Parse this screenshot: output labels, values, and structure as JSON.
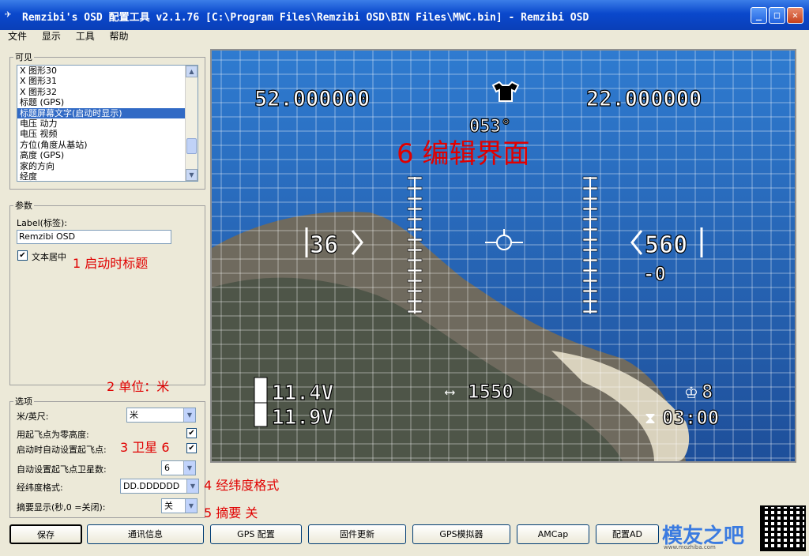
{
  "window": {
    "title": "Remzibi's OSD 配置工具 v2.1.76 [C:\\Program Files\\Remzibi OSD\\BIN Files\\MWC.bin] - Remzibi OSD"
  },
  "menu": [
    "文件",
    "显示",
    "工具",
    "帮助"
  ],
  "visible_group": {
    "legend": "可见",
    "items": [
      "X 图形30",
      "X 图形31",
      "X 图形32",
      "标题 (GPS)",
      "标题屏幕文字(启动时显示)",
      "电压 动力",
      "电压 视频",
      "方位(角度从基站)",
      "高度 (GPS)",
      "家的方向",
      "经度"
    ],
    "selected_index": 4
  },
  "params": {
    "legend": "参数",
    "label_caption": "Label(标签):",
    "label_value": "Remzibi OSD",
    "center_text_label": "文本居中"
  },
  "options": {
    "legend": "选项",
    "units_label": "米/英尺:",
    "units_value": "米",
    "zero_alt_label": "用起飞点为零高度:",
    "auto_home_label": "启动时自动设置起飞点:",
    "auto_sats_label": "自动设置起飞点卫星数:",
    "auto_sats_value": "6",
    "latlon_label": "经纬度格式:",
    "latlon_value": "DD.DDDDDD",
    "summary_label": "摘要显示(秒,0 =关闭):",
    "summary_value": "关"
  },
  "annotations": {
    "a1": "1 启动时标题",
    "a2": "2 单位：米",
    "a3": "3 卫星 6",
    "a4": "4 经纬度格式",
    "a5": "5 摘要 关",
    "a6": "6 编辑界面"
  },
  "osd": {
    "lat": "52.000000",
    "lon": "22.000000",
    "heading": "053°",
    "speed": "36",
    "altitude": "560",
    "vario": "-0",
    "bat1": "11.4V",
    "bat2": "11.9V",
    "distance": "1550",
    "sats": "8",
    "timer": "03:00"
  },
  "buttons": [
    "保存",
    "通讯信息",
    "GPS 配置",
    "固件更新",
    "GPS模拟器",
    "AMCap",
    "配置AD"
  ],
  "watermark": {
    "site": "模友之吧",
    "url": "www.mozhiba.com"
  }
}
